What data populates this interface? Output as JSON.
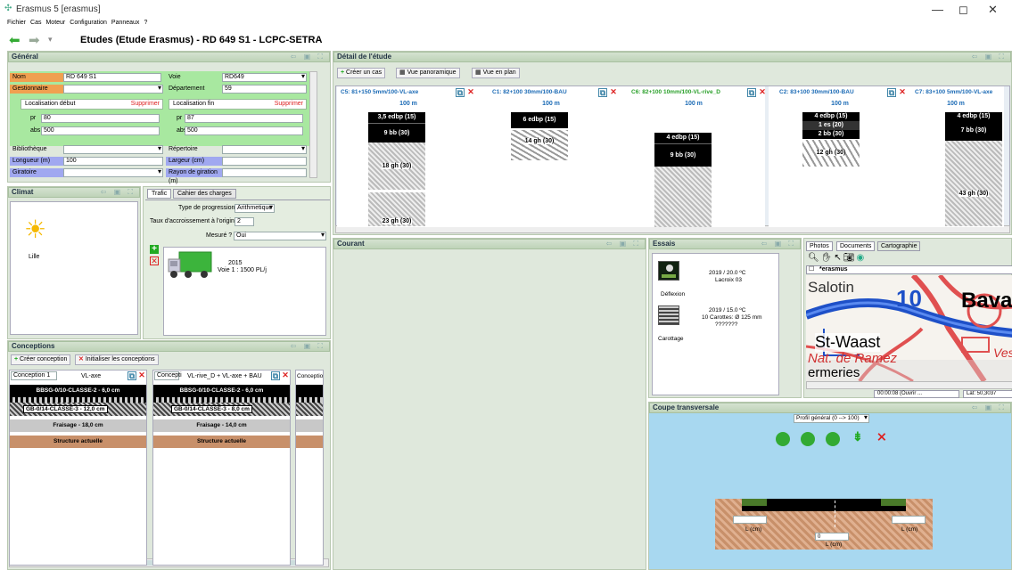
{
  "window": {
    "title": "Erasmus 5 [erasmus]",
    "min": "—",
    "max": "◻",
    "close": "✕"
  },
  "menu": [
    "Fichier",
    "Cas",
    "Moteur",
    "Configuration",
    "Panneaux",
    "?"
  ],
  "nav": {
    "title": "Etudes (Etude Erasmus) - RD 649 S1 - LCPC-SETRA"
  },
  "general": {
    "header": "Général",
    "nom_label": "Nom",
    "nom_value": "RD 649 S1",
    "voie_label": "Voie",
    "voie_value": "RD649",
    "gest_label": "Gestionnaire",
    "gest_value": "",
    "dep_label": "Département",
    "dep_value": "59",
    "loc_debut": "Localisation début",
    "loc_fin": "Localisation fin",
    "supprimer": "Supprimer",
    "pr_label": "pr",
    "pr_debut": "80",
    "pr_fin": "87",
    "abs_label": "abs",
    "abs_debut": "500",
    "abs_fin": "500",
    "biblio_label": "Bibliothèque",
    "repertoire_label": "Répertoire",
    "longueur_label": "Longueur (m)",
    "longueur_value": "100",
    "largeur_label": "Largeur (cm)",
    "largeur_value": "",
    "giratoire_label": "Giratoire",
    "rayon_label": "Rayon de giration (m)"
  },
  "detail": {
    "header": "Détail de l'étude",
    "create": "Créer un cas",
    "pano": "Vue panoramique",
    "plan": "Vue en plan",
    "cases": [
      {
        "title": "C5: 81+150 5mm/100-VL-axe",
        "len": "100 m",
        "color": "#1a6ab5"
      },
      {
        "title": "C1: 82+100 30mm/100-BAU",
        "len": "100 m",
        "color": "#1a6ab5"
      },
      {
        "title": "C6: 82+100 10mm/100-VL-rive_D",
        "len": "100 m",
        "color": "#2aa02a"
      },
      {
        "title": "C2: 83+100 30mm/100-BAU",
        "len": "100 m",
        "color": "#1a6ab5"
      },
      {
        "title": "C7: 83+100 5mm/100-VL-axe",
        "len": "100 m",
        "color": "#1a6ab5"
      }
    ],
    "layers": {
      "c5a": "3,5 edbp (15)",
      "c5b": "9 bb (30)",
      "c5c": "18 gh (30)",
      "c5d": "23 gh (30)",
      "c1a": "6 edbp (15)",
      "c1b": "14 gh (30)",
      "c6a": "4 edbp (15)",
      "c6b": "9 bb (30)",
      "c2a": "4 edbp (15)",
      "c2b": "1 es (20)",
      "c2c": "2 bb (30)",
      "c2d": "12 gh (30)",
      "c7a": "4 edbp (15)",
      "c7b": "7 bb (30)",
      "c7c": "43 gh (30)"
    }
  },
  "climat": {
    "header": "Climat",
    "city": "Lille"
  },
  "trafic": {
    "tab1": "Trafic",
    "tab2": "Cahier des charges",
    "prog_label": "Type de progression",
    "prog_value": "Arithmetique",
    "taux_label": "Taux d'accroissement à l'origine",
    "taux_value": "2",
    "mesure_label": "Mesuré ?",
    "mesure_value": "Oui",
    "year": "2015",
    "voie": "Voie 1 : 1500 PL/j"
  },
  "courant": {
    "header": "Courant"
  },
  "essais": {
    "header": "Essais",
    "e1": {
      "line1": "2019 / 20.0 ºC",
      "line2": "Lacroix 03",
      "name": "Déflexion"
    },
    "e2": {
      "line1": "2019 / 15.0 ºC",
      "line2": "10 Carottes: Ø 125 mm",
      "line3": "???????",
      "name": "Carottage"
    }
  },
  "map": {
    "tab1": "Photos",
    "tab2": "Documents",
    "tab3": "Cartographie",
    "layer": "*erasmus",
    "labels": {
      "a": "Salotin",
      "b": "10",
      "c": "Bava",
      "d": "St-Waast",
      "e": "Nat. de Ramez",
      "f": "ermeries",
      "g": "Vest"
    },
    "status1": "00:00:08 (Ouvrir ...",
    "status2": "Lat: 50,3037"
  },
  "coupe": {
    "header": "Coupe transversale",
    "profil": "Profil général (0 --> 100)",
    "lcm": "L (cm)",
    "zero": "0"
  },
  "conceptions": {
    "header": "Conceptions",
    "create": "Créer conception",
    "init": "Initialiser les conceptions",
    "c1_name": "Conception 1",
    "c1_type": "VL-axe",
    "c2_name": "Concepti",
    "c2_type": "VL-rive_D + VL-axe + BAU",
    "c3_name": "Conception",
    "l1": "BBSG-0/10-CLASSE-2 - 6,0 cm",
    "l2a": "GB-0/14-CLASSE-3 - 12,0 cm",
    "l2b": "GB-0/14-CLASSE-3 - 8,0 cm",
    "l3a": "Fraisage - 18,0 cm",
    "l3b": "Fraisage - 14,0 cm",
    "l4": "Structure actuelle"
  },
  "colors": {
    "panel_bg": "#dfe8dc",
    "header": "#c6d8c0",
    "orange": "#f0a050",
    "green_field": "#a8e8a0",
    "blue_field": "#a0a8f0",
    "sky": "#a8d8f0",
    "struct": "#c8906a"
  }
}
